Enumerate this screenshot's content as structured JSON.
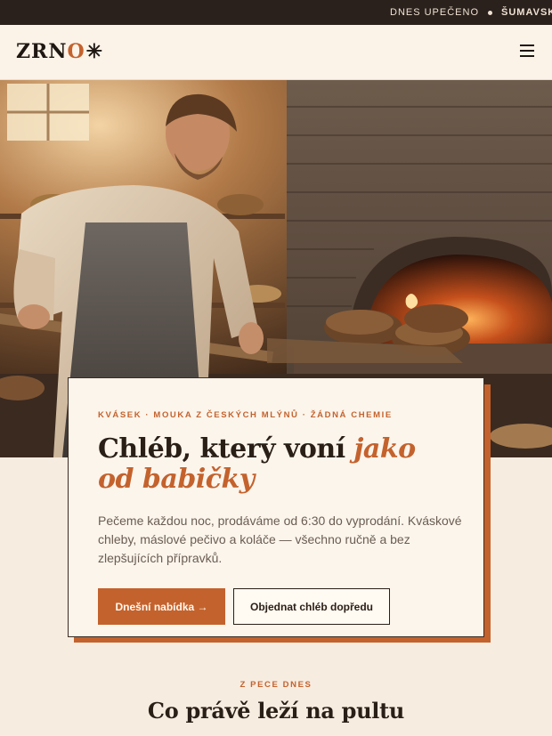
{
  "ticker": {
    "items": [
      "DNES UPEČENO",
      "ŠUMAVSKÝ K"
    ]
  },
  "header": {
    "logo_text": "ZRN",
    "logo_accent": "O",
    "logo_mark": "✳",
    "menu_icon": "hamburger-menu-icon"
  },
  "hero": {
    "image_subject": "baker-with-bread-peel-at-wood-fired-oven"
  },
  "card": {
    "eyebrow": "KVÁSEK · MOUKA Z ČESKÝCH MLÝNŮ · ŽÁDNÁ CHEMIE",
    "headline_main": "Chléb, který voní ",
    "headline_accent": "jako od babičky",
    "lead": "Pečeme každou noc, prodáváme od 6:30 do vyprodání. Kváskové chleby, máslové pečivo a koláče — všechno ručně a bez zlepšujících přípravků.",
    "primary_button": "Dnešní nabídka →",
    "secondary_button": "Objednat chléb dopředu"
  },
  "section": {
    "eyebrow": "Z PECE DNES",
    "title": "Co právě leží na pultu"
  },
  "colors": {
    "accent": "#c4622d",
    "dark": "#2b211c",
    "page_bg": "#f7ece0"
  }
}
